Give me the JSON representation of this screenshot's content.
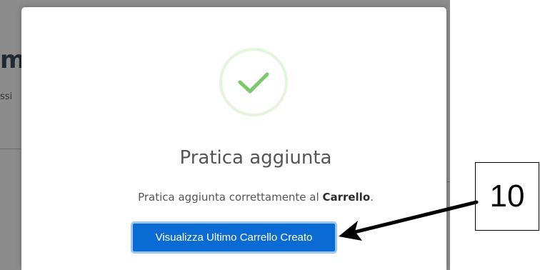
{
  "background": {
    "title_fragment": "m",
    "subtitle_fragment": "ssi"
  },
  "modal": {
    "icon": "checkmark-success-icon",
    "title": "Pratica aggiunta",
    "message_prefix": "Pratica aggiunta correttamente al ",
    "message_bold": "Carrello",
    "message_suffix": ".",
    "button_label": "Visualizza Ultimo Carrello Creato",
    "check_color": "#7ac96b",
    "button_color": "#0b6bd4"
  },
  "annotation": {
    "label": "10",
    "icon": "arrow-left-pointer"
  }
}
